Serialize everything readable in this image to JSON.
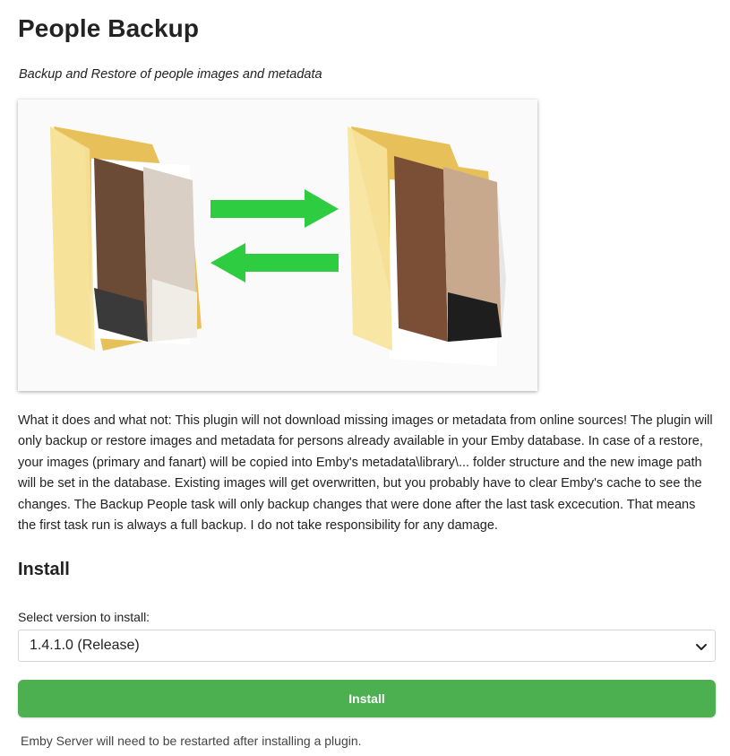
{
  "plugin": {
    "title": "People Backup",
    "subtitle": "Backup and Restore of people images and metadata",
    "description": "What it does and what not: This plugin will not download missing images or metadata from online sources! The plugin will only backup or restore images and metadata for persons already available in your Emby database. In case of a restore, your images (primary and fanart) will be copied into Emby's metadata\\library\\... folder structure and the new image path will be set in the database. Existing images will get overwritten, but you probably have to clear Emby's cache to see the changes. The Backup People task will only backup changes that were done after the last task excecution. That means the first task run is always a full backup. I do not take responsibility for any damage."
  },
  "hero_image": {
    "icons": [
      "folder-icon",
      "arrow-right-icon",
      "arrow-left-icon",
      "folder-icon"
    ]
  },
  "install": {
    "section_title": "Install",
    "version_label": "Select version to install:",
    "selected_version": "1.4.1.0 (Release)",
    "button_label": "Install",
    "note": "Emby Server will need to be restarted after installing a plugin."
  },
  "colors": {
    "accent": "#4caf50",
    "arrow": "#2ecc40",
    "folder": "#f3d57a"
  }
}
